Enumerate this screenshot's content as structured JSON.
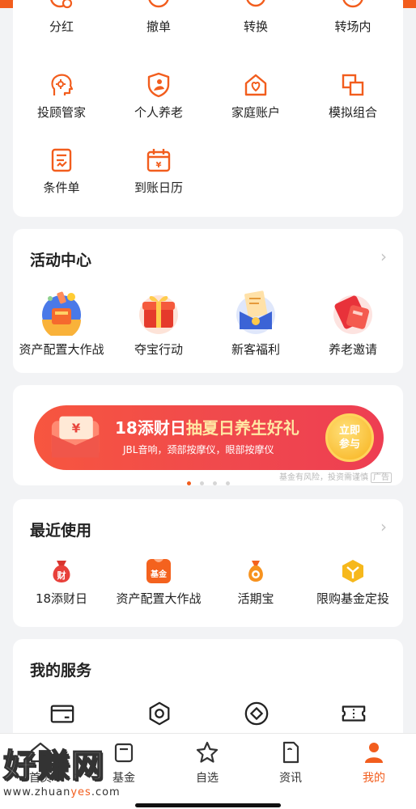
{
  "colors": {
    "accent": "#f25d1d",
    "banner": "#f0494d",
    "highlight": "#ffe7a3"
  },
  "quick_menu": {
    "items": [
      {
        "label": "分红",
        "icon": "dividend-icon"
      },
      {
        "label": "撤单",
        "icon": "cancel-order-icon"
      },
      {
        "label": "转换",
        "icon": "convert-icon"
      },
      {
        "label": "转场内",
        "icon": "transfer-in-icon"
      },
      {
        "label": "投顾管家",
        "icon": "advisor-icon"
      },
      {
        "label": "个人养老",
        "icon": "pension-icon"
      },
      {
        "label": "家庭账户",
        "icon": "family-account-icon"
      },
      {
        "label": "模拟组合",
        "icon": "simulated-portfolio-icon"
      },
      {
        "label": "条件单",
        "icon": "conditional-order-icon"
      },
      {
        "label": "到账日历",
        "icon": "arrival-calendar-icon"
      }
    ]
  },
  "activity_center": {
    "title": "活动中心",
    "items": [
      {
        "label": "资产配置大作战",
        "icon": "asset-allocation-icon"
      },
      {
        "label": "夺宝行动",
        "icon": "gift-box-icon"
      },
      {
        "label": "新客福利",
        "icon": "new-customer-icon"
      },
      {
        "label": "养老邀请",
        "icon": "red-envelope-icon"
      }
    ]
  },
  "banner": {
    "title_prefix": "18添财日",
    "title_highlight": "抽夏日养生好礼",
    "subtitle": "JBL音响，颈部按摩仪，眼部按摩仪",
    "button_line1": "立即",
    "button_line2": "参与",
    "disclaimer": "基金有风险，投资需谨慎",
    "ad_tag": "广告",
    "page_count": 4,
    "active_page": 1
  },
  "recent_use": {
    "title": "最近使用",
    "items": [
      {
        "label": "18添财日",
        "icon": "money-bag-icon",
        "glyph": "财"
      },
      {
        "label": "资产配置大作战",
        "icon": "fund-icon",
        "glyph": "基金"
      },
      {
        "label": "活期宝",
        "icon": "coin-bag-icon"
      },
      {
        "label": "限购基金定投",
        "icon": "gem-icon"
      }
    ]
  },
  "my_services": {
    "title": "我的服务",
    "items": [
      {
        "icon": "bank-card-icon"
      },
      {
        "icon": "hexagon-settings-icon"
      },
      {
        "icon": "diamond-coin-icon"
      },
      {
        "icon": "ticket-icon"
      }
    ]
  },
  "tabbar": {
    "items": [
      {
        "label": "首页",
        "icon": "home-icon"
      },
      {
        "label": "基金",
        "icon": "fund-tab-icon"
      },
      {
        "label": "自选",
        "icon": "star-icon"
      },
      {
        "label": "资讯",
        "icon": "news-icon"
      },
      {
        "label": "我的",
        "icon": "user-icon"
      }
    ],
    "active": "我的"
  },
  "watermark": {
    "brand": "好赚网",
    "url_prefix": "www.zhuan",
    "url_highlight": "yes",
    "url_suffix": ".com"
  }
}
